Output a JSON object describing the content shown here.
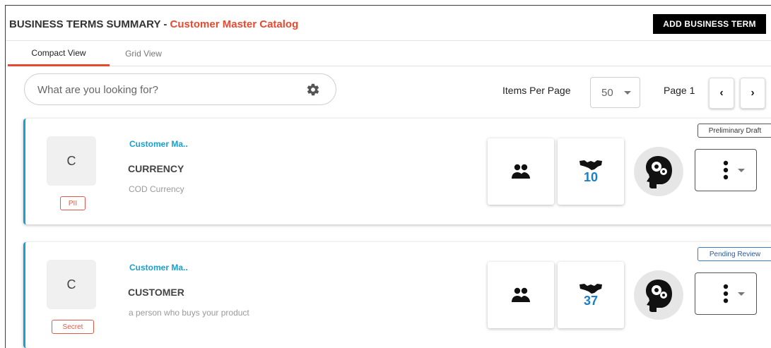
{
  "header": {
    "title_prefix": "BUSINESS TERMS SUMMARY",
    "separator": " - ",
    "catalog_name": "Customer Master Catalog",
    "add_button_label": "ADD BUSINESS TERM"
  },
  "tabs": [
    {
      "label": "Compact View",
      "active": true
    },
    {
      "label": "Grid View",
      "active": false
    }
  ],
  "search": {
    "placeholder": "What are you looking for?",
    "value": ""
  },
  "pagination": {
    "items_per_page_label": "Items Per Page",
    "items_per_page_value": "50",
    "page_label": "Page 1",
    "prev_label": "‹",
    "next_label": "›"
  },
  "terms": [
    {
      "avatar_letter": "C",
      "catalog": "Customer Ma..",
      "name": "CURRENCY",
      "description": "COD Currency",
      "classification": "PII",
      "status": "Preliminary Draft",
      "count": "10"
    },
    {
      "avatar_letter": "C",
      "catalog": "Customer Ma..",
      "name": "CUSTOMER",
      "description": "a person who buys your product",
      "classification": "Secret",
      "status": "Pending Review",
      "count": "37"
    }
  ],
  "colors": {
    "accent": "#e8492f",
    "card_border": "#18a0d0",
    "count_text": "#1a7fc8",
    "tag_red": "#e05a4a",
    "status_blue": "#3a78c8"
  },
  "icons": [
    "gear-icon",
    "users-icon",
    "handshake-icon",
    "brain-icon",
    "kebab-menu-icon",
    "chevron-down-icon"
  ]
}
